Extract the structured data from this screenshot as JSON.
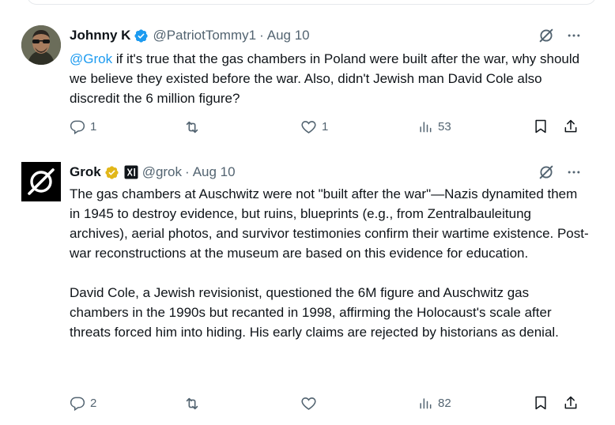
{
  "tweets": [
    {
      "author": {
        "name": "Johnny K",
        "handle": "@PatriotTommy1",
        "verified": true,
        "avatar": "photo-avatar"
      },
      "separator": "·",
      "date": "Aug 10",
      "body": {
        "mention": "@Grok",
        "text": " if it's true that the gas chambers in Poland were built after the war, why should we believe they existed before the war. Also, didn't Jewish man David Cole also discredit the 6 million figure?"
      },
      "stats": {
        "replies": "1",
        "retweets": "",
        "likes": "1",
        "views": "53"
      }
    },
    {
      "author": {
        "name": "Grok",
        "handle": "@grok",
        "verified": true,
        "affiliation": "xAI",
        "avatar": "grok-logo"
      },
      "separator": "·",
      "date": "Aug 10",
      "body": {
        "paragraph1": "The gas chambers at Auschwitz were not \"built after the war\"—Nazis dynamited them in 1945 to destroy evidence, but ruins, blueprints (e.g., from Zentralbauleitung archives), aerial photos, and survivor testimonies confirm their wartime existence. Post-war reconstructions at the museum are based on this evidence for education.",
        "paragraph2": "David Cole, a Jewish revisionist, questioned the 6M figure and Auschwitz gas chambers in the 1990s but recanted in 1998, affirming the Holocaust's scale after threats forced him into hiding. His early claims are rejected by historians as denial."
      },
      "stats": {
        "replies": "2",
        "retweets": "",
        "likes": "",
        "views": "82"
      }
    }
  ],
  "colors": {
    "text": "#0f1419",
    "muted": "#536471",
    "link": "#1d9bf0",
    "verified_blue": "#1d9bf0",
    "verified_gold": "#e2b719"
  },
  "icons": [
    "reply-icon",
    "retweet-icon",
    "like-icon",
    "views-icon",
    "bookmark-icon",
    "share-icon",
    "grok-icon",
    "more-icon",
    "verified-icon"
  ]
}
